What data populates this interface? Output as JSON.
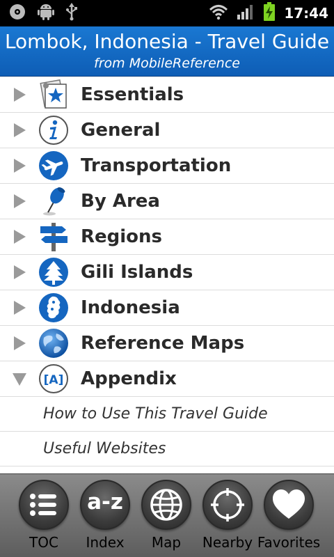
{
  "status_bar": {
    "time": "17:44",
    "icons": [
      "cd-icon",
      "android-debug-icon",
      "usb-icon",
      "wifi-icon",
      "signal-icon",
      "battery-charging-icon"
    ]
  },
  "header": {
    "title": "Lombok, Indonesia - Travel Guide",
    "subtitle": "from MobileReference"
  },
  "toc": {
    "items": [
      {
        "label": "Essentials",
        "icon": "star-icon",
        "expanded": false
      },
      {
        "label": "General",
        "icon": "info-icon",
        "expanded": false
      },
      {
        "label": "Transportation",
        "icon": "airplane-icon",
        "expanded": false
      },
      {
        "label": "By Area",
        "icon": "pushpin-icon",
        "expanded": false
      },
      {
        "label": "Regions",
        "icon": "signpost-icon",
        "expanded": false
      },
      {
        "label": "Gili Islands",
        "icon": "tree-icon",
        "expanded": false
      },
      {
        "label": "Indonesia",
        "icon": "country-map-icon",
        "expanded": false
      },
      {
        "label": "Reference Maps",
        "icon": "globe-icon",
        "expanded": false
      },
      {
        "label": "Appendix",
        "icon": "appendix-icon",
        "expanded": true
      }
    ],
    "appendix_icon_text": "[A]",
    "sub_items": [
      {
        "label": "How to Use This Travel Guide"
      },
      {
        "label": "Useful Websites"
      }
    ]
  },
  "toolbar": {
    "buttons": [
      {
        "label": "TOC",
        "icon": "list-icon"
      },
      {
        "label": "Index",
        "icon": "a-z-icon",
        "glyph": "a-z"
      },
      {
        "label": "Map",
        "icon": "globe-icon"
      },
      {
        "label": "Nearby",
        "icon": "crosshair-icon"
      },
      {
        "label": "Favorites",
        "icon": "heart-icon"
      }
    ]
  },
  "colors": {
    "header_blue": "#1565c0",
    "status_bar": "#000000",
    "toolbar_gray": "#7a7a7a",
    "icon_blue": "#1566c0"
  }
}
